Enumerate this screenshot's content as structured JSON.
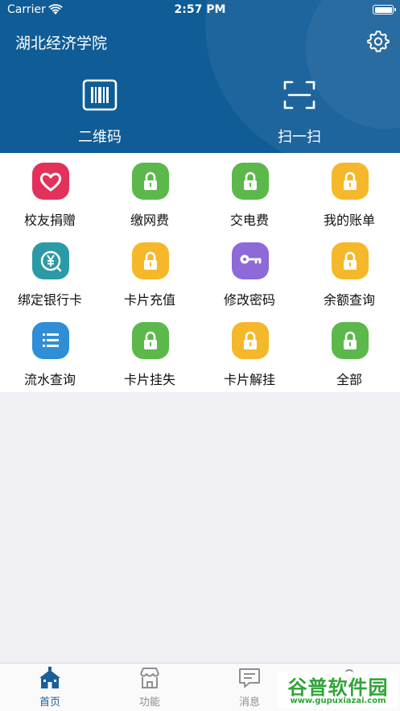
{
  "status_bar": {
    "carrier": "Carrier",
    "time": "2:57 PM"
  },
  "header": {
    "title": "湖北经济学院",
    "settings_icon": "gear-icon",
    "background_color": "#0f5c96",
    "actions": [
      {
        "label": "二维码",
        "icon": "barcode-icon"
      },
      {
        "label": "扫一扫",
        "icon": "scan-frame-icon"
      }
    ]
  },
  "grid": {
    "items": [
      {
        "label": "校友捐赠",
        "icon": "heart-icon",
        "color": "#e2315b"
      },
      {
        "label": "缴网费",
        "icon": "lock-icon",
        "color": "#5cb84a"
      },
      {
        "label": "交电费",
        "icon": "lock-icon",
        "color": "#5cb84a"
      },
      {
        "label": "我的账单",
        "icon": "lock-icon",
        "color": "#f5b82a"
      },
      {
        "label": "绑定银行卡",
        "icon": "yen-icon",
        "color": "#2c9aa6"
      },
      {
        "label": "卡片充值",
        "icon": "lock-icon",
        "color": "#f5b82a"
      },
      {
        "label": "修改密码",
        "icon": "key-icon",
        "color": "#8d6ad8"
      },
      {
        "label": "余额查询",
        "icon": "lock-icon",
        "color": "#f5b82a"
      },
      {
        "label": "流水查询",
        "icon": "list-icon",
        "color": "#2f8ed6"
      },
      {
        "label": "卡片挂失",
        "icon": "lock-icon",
        "color": "#5cb84a"
      },
      {
        "label": "卡片解挂",
        "icon": "lock-icon",
        "color": "#f5b82a"
      },
      {
        "label": "全部",
        "icon": "lock-icon",
        "color": "#5cb84a"
      }
    ]
  },
  "tabbar": {
    "active_color": "#1a5e9a",
    "tabs": [
      {
        "label": "首页",
        "icon": "home-icon",
        "active": true
      },
      {
        "label": "功能",
        "icon": "store-icon",
        "active": false
      },
      {
        "label": "消息",
        "icon": "message-icon",
        "active": false
      },
      {
        "label": "",
        "icon": "profile-icon",
        "active": false
      }
    ]
  },
  "watermark": {
    "title": "谷普软件园",
    "url": "www.gupuxiazai.com"
  }
}
